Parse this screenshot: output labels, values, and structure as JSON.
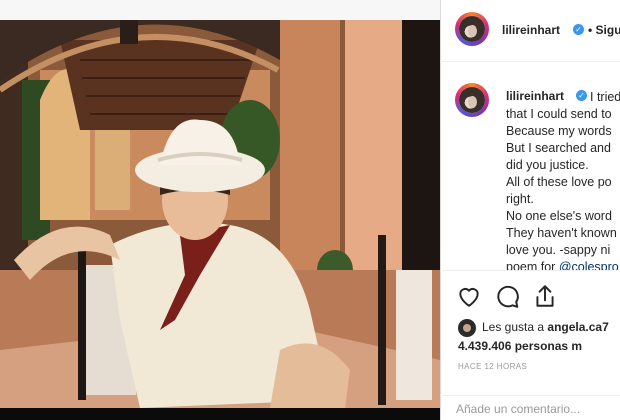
{
  "post": {
    "author": "lilireinhart",
    "follow_separator": "•",
    "follow_label": "Sigu",
    "caption_lines": [
      "I tried",
      "that I could send to",
      "Because my words",
      "But I searched and",
      "did you justice.",
      "All of these love po",
      "right.",
      "No one else's word",
      "They haven't known",
      "love you. -sappy ni",
      "poem for "
    ],
    "caption_mention": "@colespro",
    "likes_prefix": "Les gusta a ",
    "likes_user": "angela.ca7",
    "likes_count": "4.439.406 personas m",
    "timestamp": "HACE 12 HORAS",
    "comment_placeholder": "Añade un comentario..."
  },
  "icons": {
    "like": "heart-icon",
    "comment": "speech-bubble-icon",
    "share": "share-icon",
    "verified": "verified-badge-icon"
  },
  "colors": {
    "verified_blue": "#3897f0",
    "mention_blue": "#003569",
    "story_ring": "#dd2a7b",
    "muted_text": "#999999"
  }
}
